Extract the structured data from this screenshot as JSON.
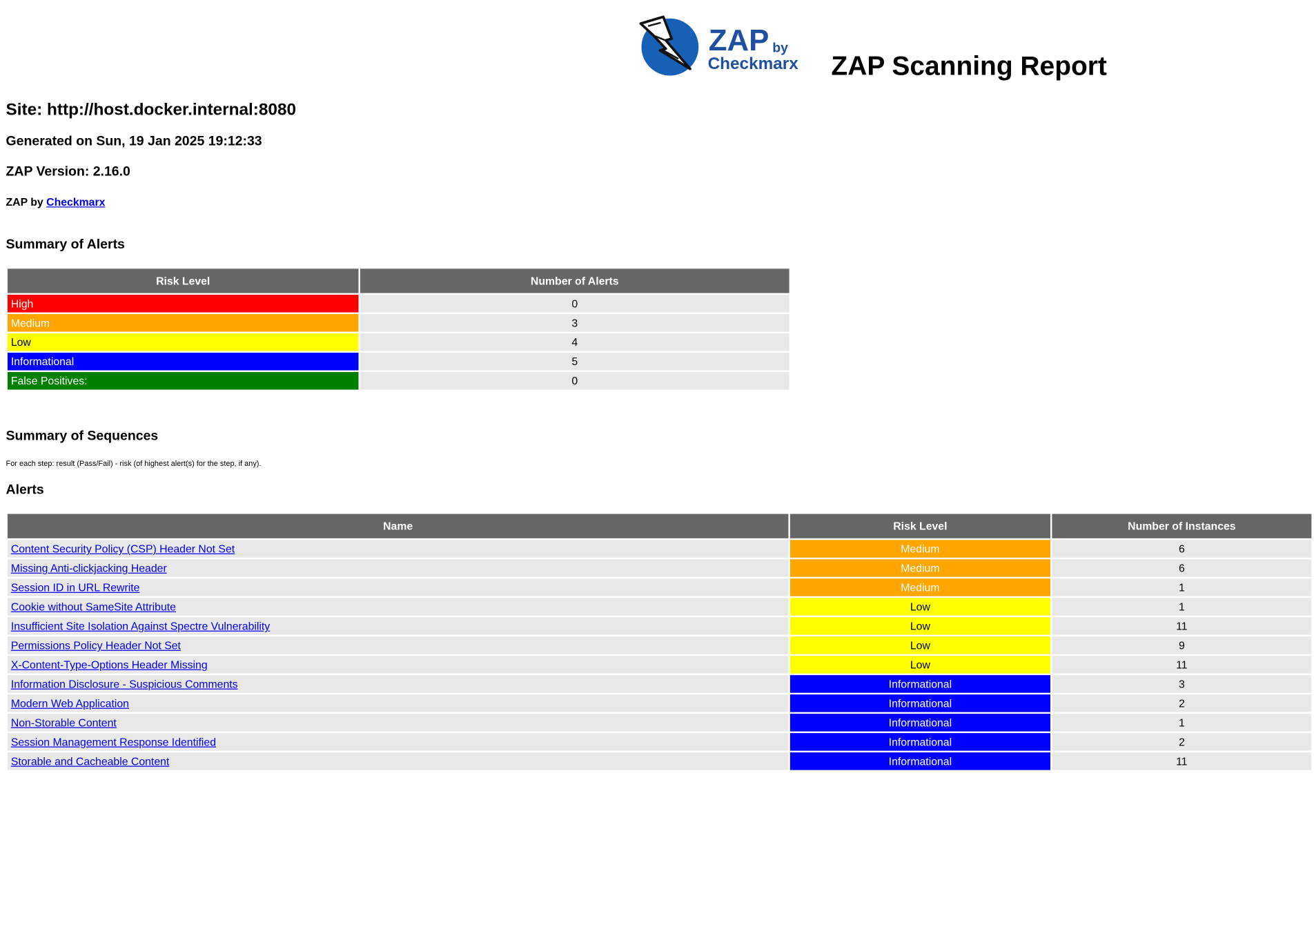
{
  "report": {
    "title": "ZAP Scanning Report",
    "site": "Site: http://host.docker.internal:8080",
    "generated": "Generated on Sun, 19 Jan 2025 19:12:33",
    "version": "ZAP Version: 2.16.0",
    "byline_prefix": "ZAP by",
    "byline_link": "Checkmarx"
  },
  "logo": {
    "line1": "ZAP",
    "line1_small": "by",
    "line2": "Checkmarx",
    "icon": "lightning-bolt-icon",
    "circle_color": "#1760b8",
    "text_color": "#1f4fa0"
  },
  "summary": {
    "title": "Summary of Alerts",
    "headers": [
      "Risk Level",
      "Number of Alerts"
    ],
    "rows": [
      {
        "label": "High",
        "count": "0",
        "color": "#ff0000"
      },
      {
        "label": "Medium",
        "count": "3",
        "color": "#ffa500"
      },
      {
        "label": "Low",
        "count": "4",
        "color": "#ffff00"
      },
      {
        "label": "Informational",
        "count": "5",
        "color": "#0000ff"
      },
      {
        "label": "False Positives:",
        "count": "0",
        "color": "#008000"
      }
    ]
  },
  "sequences": {
    "title": "Summary of Sequences",
    "note": "For each step: result (Pass/Fail) - risk (of highest alert(s) for the step, if any)."
  },
  "alerts": {
    "title": "Alerts",
    "headers": [
      "Name",
      "Risk Level",
      "Number of Instances"
    ],
    "rows": [
      {
        "name": "Content Security Policy (CSP) Header Not Set",
        "risk": "Medium",
        "instances": "6"
      },
      {
        "name": "Missing Anti-clickjacking Header",
        "risk": "Medium",
        "instances": "6"
      },
      {
        "name": "Session ID in URL Rewrite",
        "risk": "Medium",
        "instances": "1"
      },
      {
        "name": "Cookie without SameSite Attribute",
        "risk": "Low",
        "instances": "1"
      },
      {
        "name": "Insufficient Site Isolation Against Spectre Vulnerability",
        "risk": "Low",
        "instances": "11"
      },
      {
        "name": "Permissions Policy Header Not Set",
        "risk": "Low",
        "instances": "9"
      },
      {
        "name": "X-Content-Type-Options Header Missing",
        "risk": "Low",
        "instances": "11"
      },
      {
        "name": "Information Disclosure - Suspicious Comments",
        "risk": "Informational",
        "instances": "3"
      },
      {
        "name": "Modern Web Application",
        "risk": "Informational",
        "instances": "2"
      },
      {
        "name": "Non-Storable Content",
        "risk": "Informational",
        "instances": "1"
      },
      {
        "name": "Session Management Response Identified",
        "risk": "Informational",
        "instances": "2"
      },
      {
        "name": "Storable and Cacheable Content",
        "risk": "Informational",
        "instances": "11"
      }
    ]
  }
}
